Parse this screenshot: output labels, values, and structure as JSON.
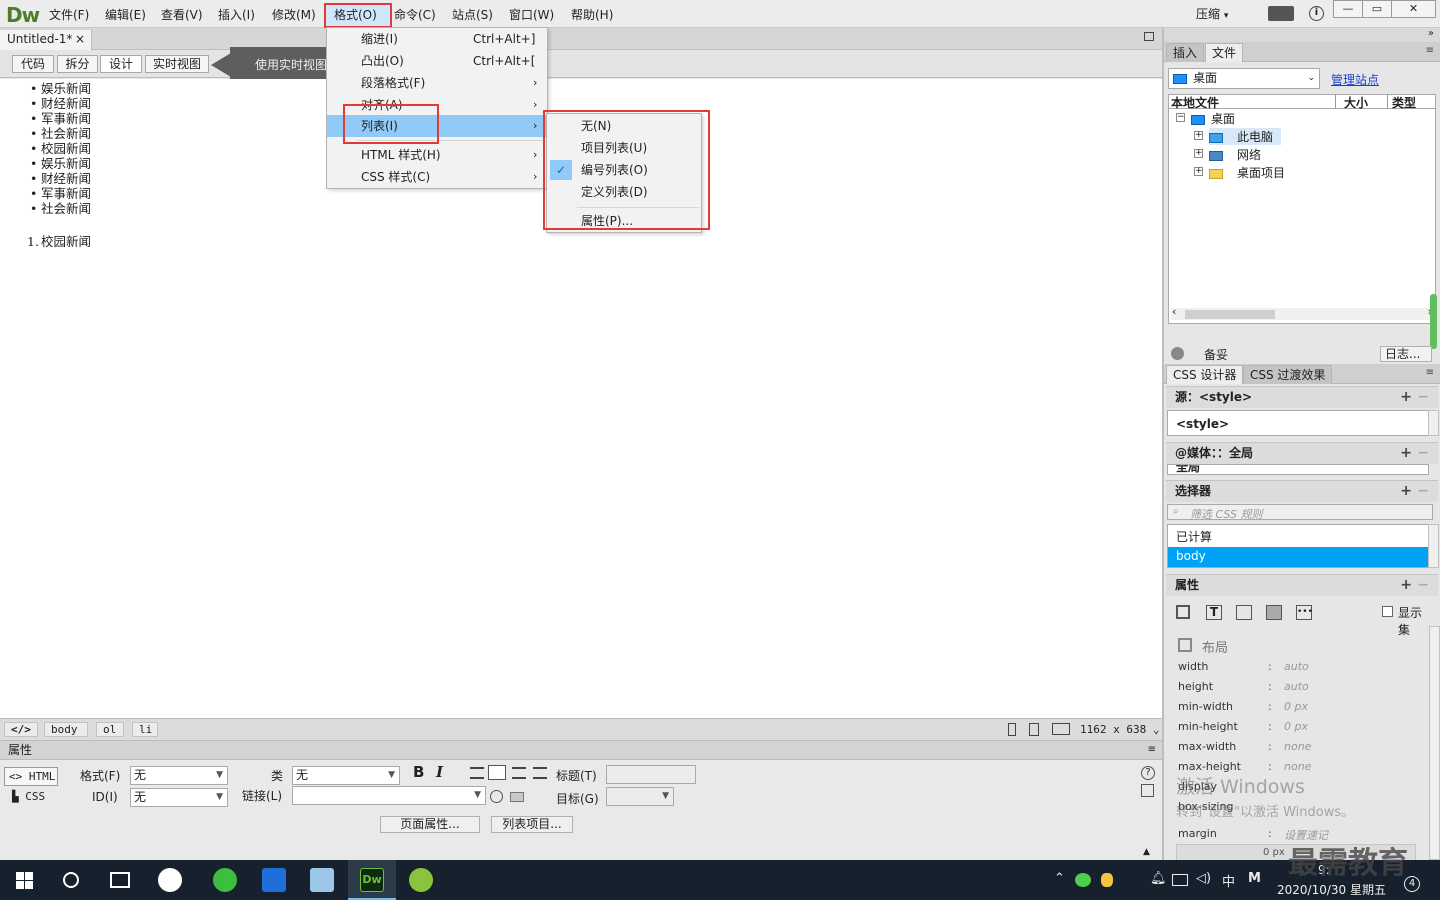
{
  "app": {
    "logo": "Dw",
    "menus": [
      "文件(F)",
      "编辑(E)",
      "查看(V)",
      "插入(I)",
      "修改(M)",
      "格式(O)",
      "命令(C)",
      "站点(S)",
      "窗口(W)",
      "帮助(H)"
    ],
    "compress_label": "压缩",
    "info_icon": "i",
    "window_controls": [
      "—",
      "▭",
      "✕"
    ]
  },
  "document": {
    "tab_label": "Untitled-1*",
    "tab_close": "×",
    "view_buttons": [
      "代码",
      "拆分",
      "设计",
      "实时视图"
    ],
    "live_tip": "使用实时视图",
    "bullet_items": [
      "娱乐新闻",
      "财经新闻",
      "军事新闻",
      "社会新闻",
      "校园新闻",
      "娱乐新闻",
      "财经新闻",
      "军事新闻",
      "社会新闻"
    ],
    "ordered_number": "1.",
    "ordered_item": "校园新闻"
  },
  "format_menu": {
    "items": [
      {
        "label": "缩进(I)",
        "shortcut": "Ctrl+Alt+]"
      },
      {
        "label": "凸出(O)",
        "shortcut": "Ctrl+Alt+["
      },
      {
        "label": "段落格式(F)",
        "arrow": "›"
      },
      {
        "label": "对齐(A)",
        "arrow": "›"
      },
      {
        "label": "列表(I)",
        "arrow": "›"
      },
      {
        "label": "HTML 样式(H)",
        "arrow": "›"
      },
      {
        "label": "CSS 样式(C)",
        "arrow": "›"
      }
    ]
  },
  "list_submenu": {
    "items": [
      "无(N)",
      "项目列表(U)",
      "编号列表(O)",
      "定义列表(D)",
      "属性(P)..."
    ],
    "checkmark": "✓"
  },
  "status_bar": {
    "code_tag": "</>",
    "tags": [
      "body",
      "ol",
      "li"
    ],
    "size": "1162 x 638"
  },
  "properties": {
    "title": "属性",
    "mode_html": "<> HTML",
    "mode_css": "CSS",
    "format_label": "格式(F)",
    "format_value": "无",
    "id_label": "ID(I)",
    "id_value": "无",
    "class_label": "类",
    "class_value": "无",
    "link_label": "链接(L)",
    "bold": "B",
    "italic": "I",
    "title_label": "标题(T)",
    "target_label": "目标(G)",
    "page_props_btn": "页面属性...",
    "list_item_btn": "列表项目...",
    "help_icon": "?"
  },
  "right_panel": {
    "tabs": [
      "插入",
      "文件"
    ],
    "site_select": "桌面",
    "manage_site": "管理站点",
    "file_columns": [
      "本地文件",
      "大小",
      "类型"
    ],
    "tree": [
      {
        "label": "桌面",
        "toggle": "−"
      },
      {
        "label": "此电脑",
        "toggle": "+"
      },
      {
        "label": "网络",
        "toggle": "+"
      },
      {
        "label": "桌面项目",
        "toggle": "+"
      }
    ],
    "ready_label": "备妥",
    "log_btn": "日志...",
    "css_tabs": [
      "CSS 设计器",
      "CSS 过渡效果"
    ],
    "source_header": "源：<style>",
    "source_item": "<style>",
    "media_header": "@媒体：：全局",
    "media_item": "全局",
    "selector_header": "选择器",
    "filter_placeholder": "筛选 CSS 规则",
    "computed_label": "已计算",
    "selected_selector": "body",
    "props_header": "属性",
    "show_set": "显示集",
    "layout_group": "布局",
    "css_props": [
      {
        "name": "width",
        "value": "auto"
      },
      {
        "name": "height",
        "value": "auto"
      },
      {
        "name": "min-width",
        "value": "0 px"
      },
      {
        "name": "min-height",
        "value": "0 px"
      },
      {
        "name": "max-width",
        "value": "none"
      },
      {
        "name": "max-height",
        "value": "none"
      },
      {
        "name": "display",
        "value": ""
      },
      {
        "name": "box-sizing",
        "value": ""
      },
      {
        "name": "margin",
        "value": "设置速记"
      }
    ],
    "margin_zero": "0 px"
  },
  "watermarks": {
    "activate_title": "激活 Windows",
    "activate_sub": "转到\"设置\"以激活 Windows。",
    "brand": "最需教育"
  },
  "taskbar": {
    "ime": "中",
    "ime_m": "M",
    "time": "9:",
    "date": "2020/10/30 星期五",
    "notify_count": "4"
  },
  "colors": {
    "highlight": "#91c9f7",
    "annotation_red": "#e03a3a",
    "selection_blue": "#00a2f5",
    "link_blue": "#1a3fcf"
  }
}
